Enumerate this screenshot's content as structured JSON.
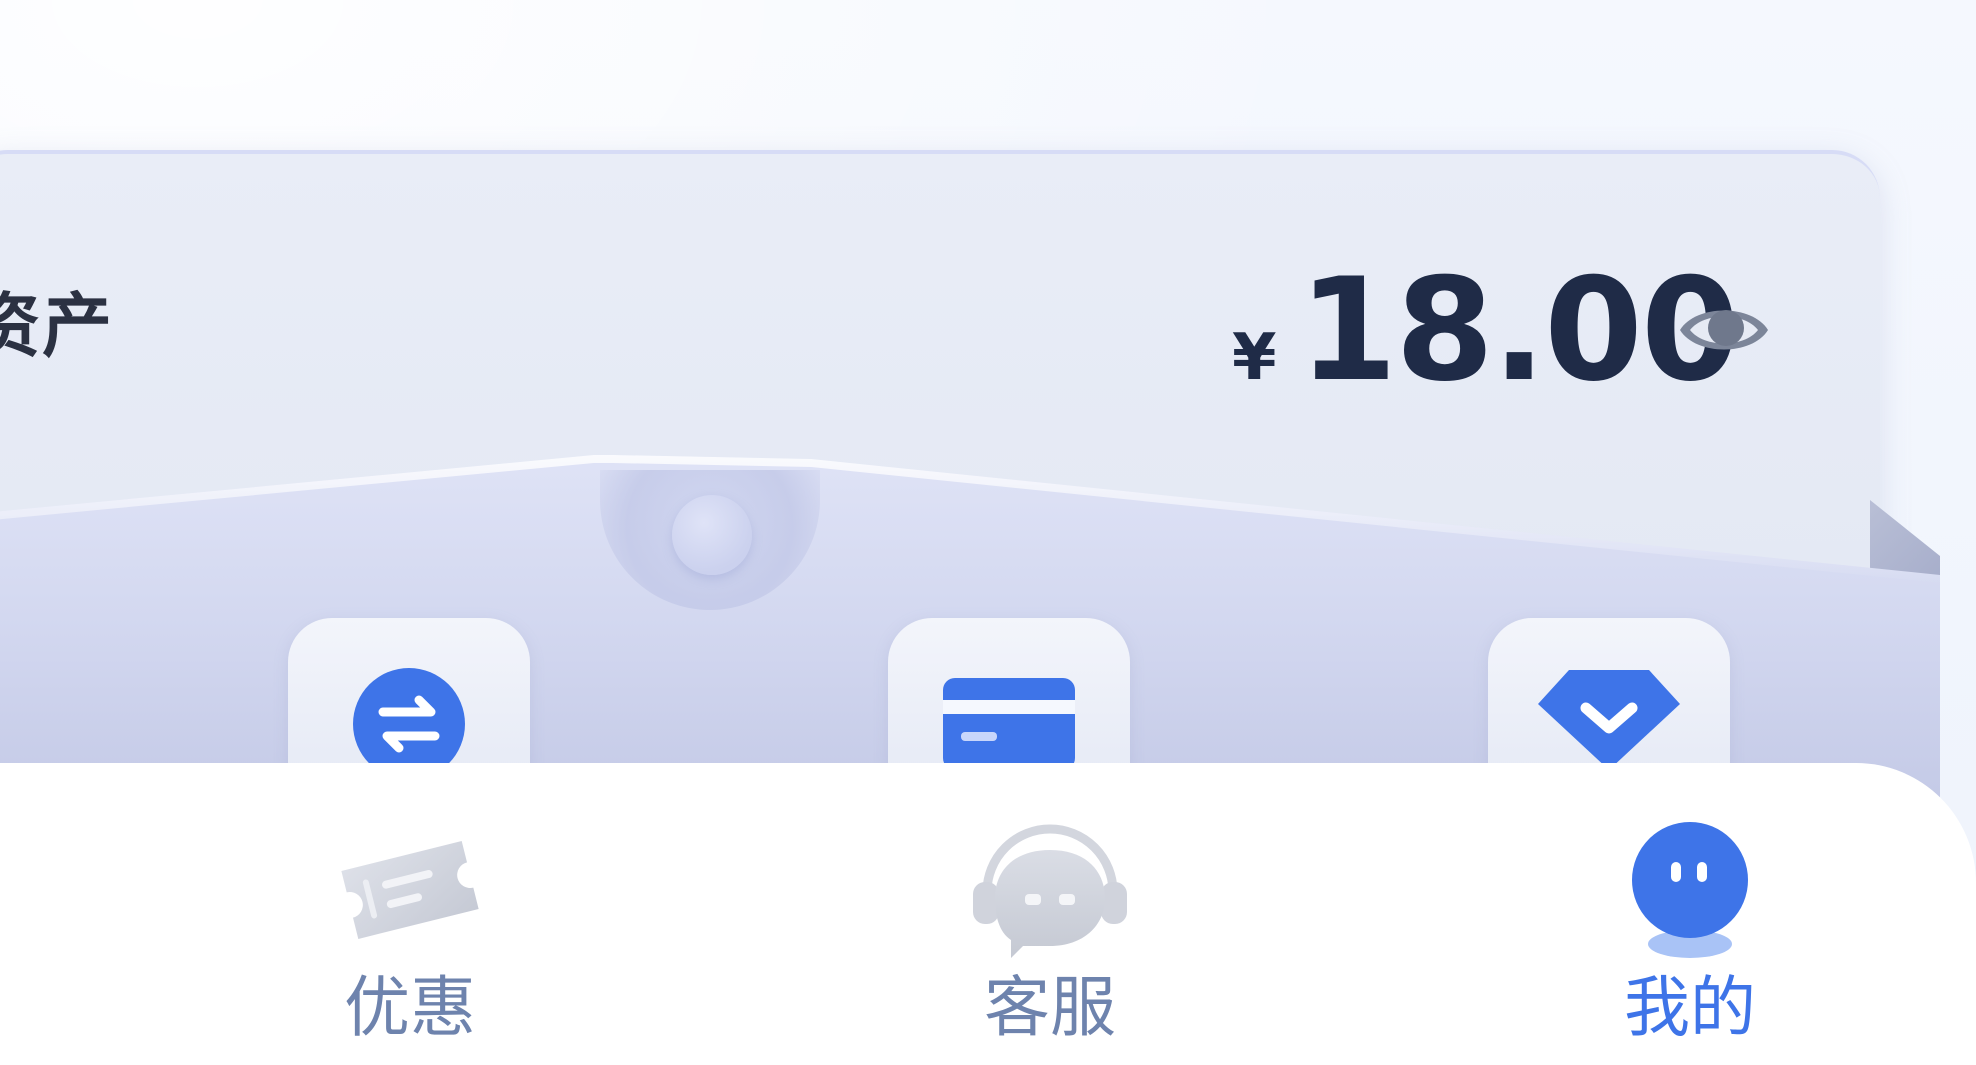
{
  "asset_card": {
    "title_fragment": "资产",
    "currency": "¥",
    "amount": "18.00",
    "toggle_icon": "eye-icon"
  },
  "quick_actions": [
    {
      "icon": "transfer-icon"
    },
    {
      "icon": "card-icon"
    },
    {
      "icon": "shield-check-icon"
    }
  ],
  "tabbar": {
    "items": [
      {
        "label": "优惠",
        "icon": "coupon-ticket-icon",
        "active": false
      },
      {
        "label": "客服",
        "icon": "headset-support-icon",
        "active": false
      },
      {
        "label": "我的",
        "icon": "profile-avatar-icon",
        "active": true
      }
    ]
  },
  "colors": {
    "accent": "#3e74e8",
    "amount_text": "#1f2b47",
    "inactive_tab": "#6e83ad"
  }
}
